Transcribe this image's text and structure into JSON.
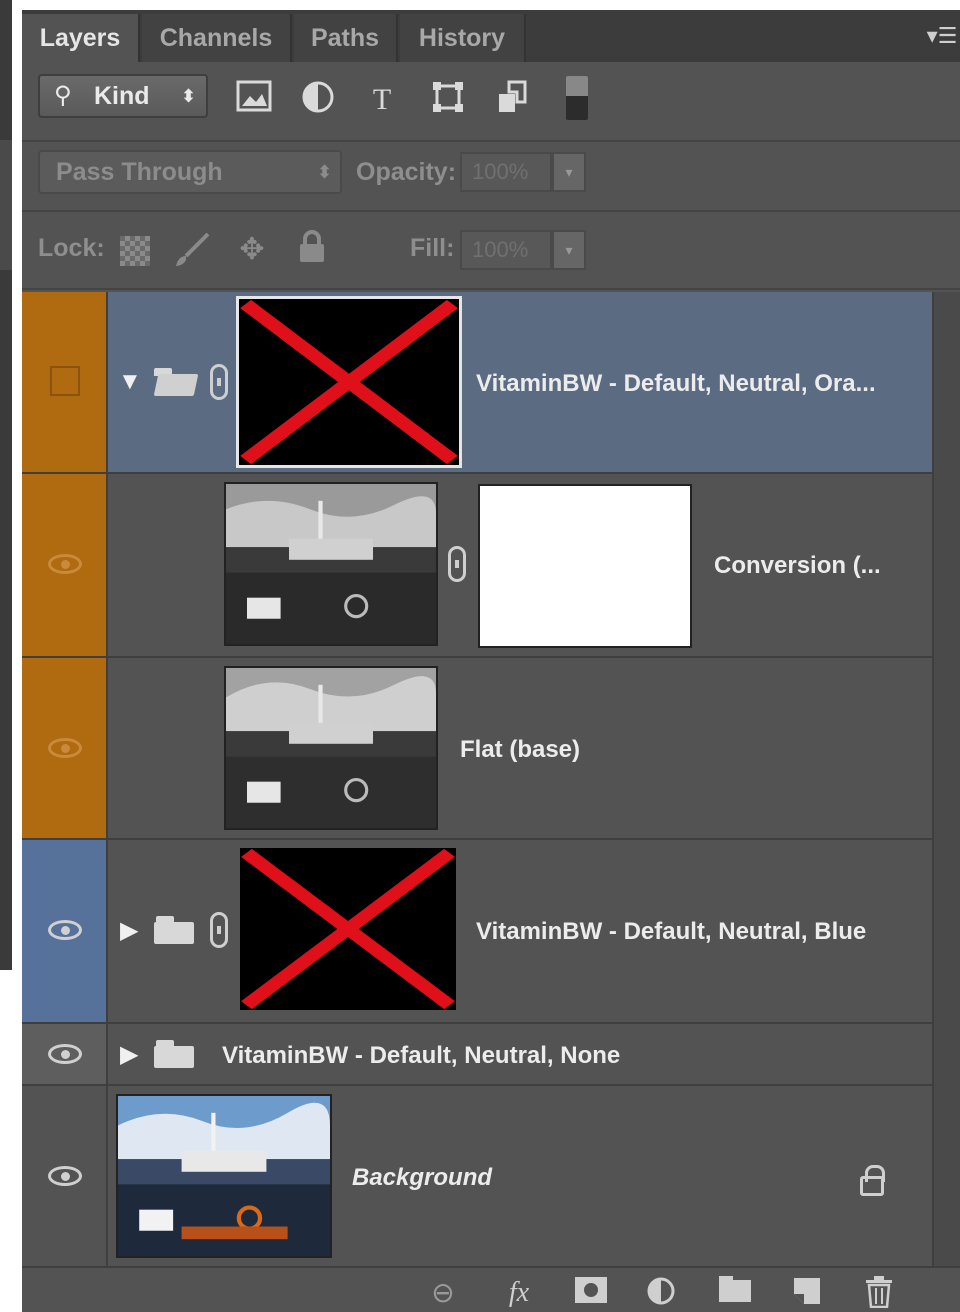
{
  "tabs": [
    {
      "label": "Layers",
      "active": true
    },
    {
      "label": "Channels",
      "active": false
    },
    {
      "label": "Paths",
      "active": false
    },
    {
      "label": "History",
      "active": false
    }
  ],
  "filter": {
    "kind_label": "Kind",
    "kind_arrows": "⬍",
    "icons": [
      "image-filter-icon",
      "adjustment-filter-icon",
      "type-filter-icon",
      "shape-filter-icon",
      "smart-object-filter-icon"
    ]
  },
  "blend": {
    "mode": "Pass Through",
    "arrows": "⬍",
    "opacity_label": "Opacity:",
    "opacity_value": "100%",
    "dropdown_glyph": "▾"
  },
  "lock": {
    "label": "Lock:",
    "fill_label": "Fill:",
    "fill_value": "100%",
    "dropdown_glyph": "▾"
  },
  "layers": [
    {
      "name": "VitaminBW - Default, Neutral, Ora...",
      "type": "group",
      "expanded": true,
      "selected": true,
      "visible": false,
      "color_label": "orange"
    },
    {
      "name": "Conversion (...",
      "type": "adjustment",
      "visible": true,
      "color_label": "orange"
    },
    {
      "name": "Flat (base)",
      "type": "pixel",
      "visible": true,
      "color_label": "orange"
    },
    {
      "name": "VitaminBW - Default, Neutral, Blue",
      "type": "group",
      "expanded": false,
      "visible": true,
      "color_label": "blue"
    },
    {
      "name": "VitaminBW - Default, Neutral, None",
      "type": "group",
      "expanded": false,
      "visible": true,
      "color_label": "none"
    },
    {
      "name": "Background",
      "type": "background",
      "visible": true,
      "locked": true
    }
  ],
  "colors": {
    "panel_bg": "#535353",
    "selected_row": "#5a6b82",
    "label_orange": "#b06a0f",
    "label_blue": "#56719a",
    "missing_thumb_x": "#e0101a"
  },
  "footer_icons": [
    "link-layers-icon",
    "fx-icon",
    "add-mask-icon",
    "new-adjustment-icon",
    "new-group-icon",
    "new-layer-icon",
    "delete-icon"
  ]
}
